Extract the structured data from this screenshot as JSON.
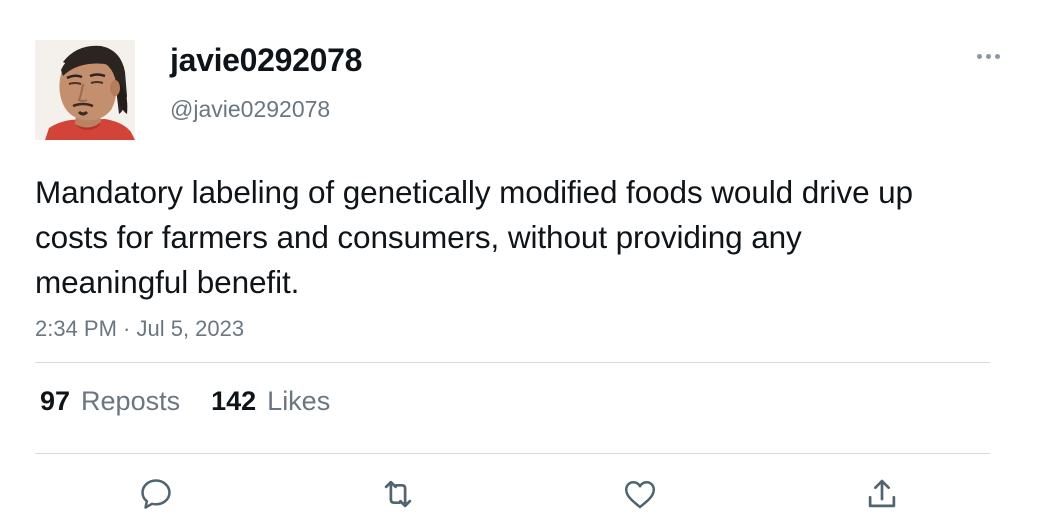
{
  "user": {
    "display_name": "javie0292078",
    "handle": "@javie0292078"
  },
  "tweet": {
    "text": "Mandatory labeling of genetically modified foods would drive up costs for farmers and consumers, without providing any meaningful benefit.",
    "timestamp": "2:34 PM · Jul 5, 2023"
  },
  "stats": {
    "reposts_count": "97",
    "reposts_label": "Reposts",
    "likes_count": "142",
    "likes_label": "Likes"
  },
  "actions": {
    "reply_icon": "reply-icon",
    "repost_icon": "repost-icon",
    "like_icon": "heart-icon",
    "share_icon": "share-icon"
  },
  "colors": {
    "text": "#0f1419",
    "secondary": "#6a7680",
    "divider": "#d6dbe0",
    "icon": "#536471"
  }
}
